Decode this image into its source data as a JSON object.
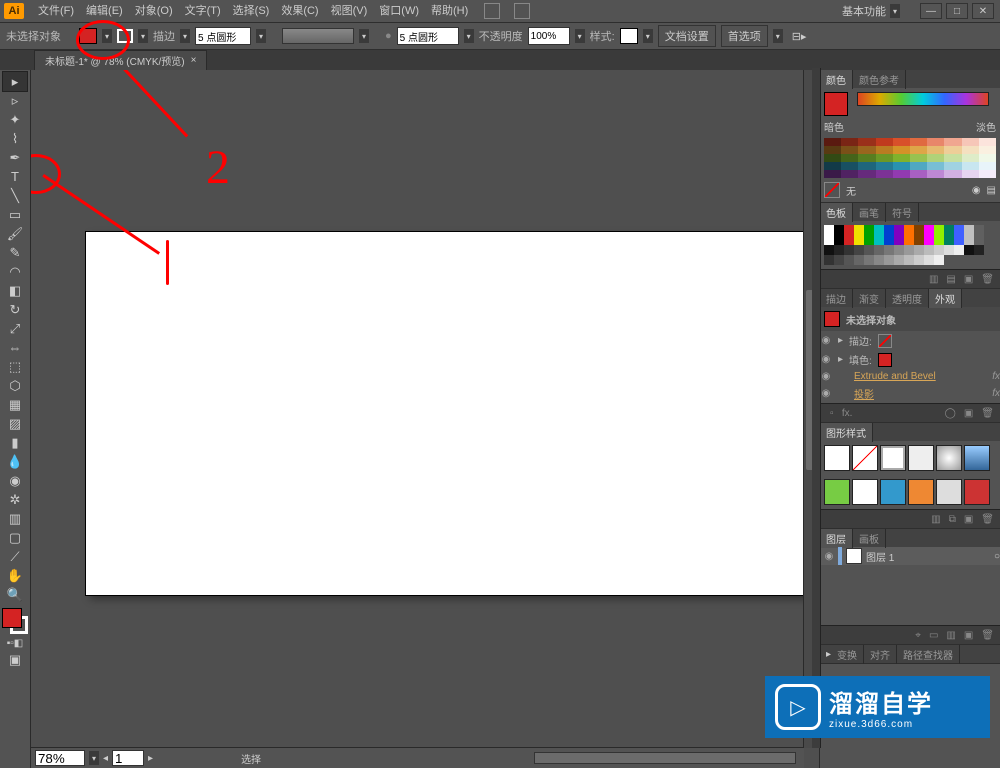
{
  "menubar": {
    "logo": "Ai",
    "items": [
      "文件(F)",
      "编辑(E)",
      "对象(O)",
      "文字(T)",
      "选择(S)",
      "效果(C)",
      "视图(V)",
      "窗口(W)",
      "帮助(H)"
    ],
    "workspace": "基本功能"
  },
  "control": {
    "status": "未选择对象",
    "stroke_label": "描边",
    "stroke_weight": "5 点圆形",
    "opacity_label": "不透明度",
    "opacity_value": "100%",
    "style_label": "样式:",
    "doc_setup": "文档设置",
    "prefs": "首选项"
  },
  "tab": {
    "title": "未标题-1* @ 78% (CMYK/预览)",
    "close": "×"
  },
  "bottom": {
    "zoom": "78%",
    "page": "1",
    "tool": "选择"
  },
  "panels": {
    "color": {
      "tabs": [
        "颜色",
        "颜色参考"
      ],
      "dark": "暗色",
      "light": "淡色",
      "none": "无"
    },
    "swatches": {
      "tabs": [
        "色板",
        "画笔",
        "符号"
      ]
    },
    "appearance": {
      "tabs": [
        "描边",
        "渐变",
        "透明度",
        "外观"
      ],
      "no_sel": "未选择对象",
      "rows": [
        {
          "label": "描边:",
          "link": false
        },
        {
          "label": "填色:",
          "link": false
        },
        {
          "label": "Extrude and Bevel",
          "link": true
        },
        {
          "label": "投影",
          "link": true
        }
      ]
    },
    "gstyles": {
      "tabs": [
        "图形样式"
      ]
    },
    "layers": {
      "tabs": [
        "图层",
        "画板"
      ],
      "layer1": "图层 1"
    },
    "footer": {
      "tabs": [
        "变换",
        "对齐",
        "路径查找器"
      ]
    }
  },
  "watermark": {
    "brand": "溜溜自学",
    "url": "zixue.3d66.com"
  },
  "colors": {
    "fill": "#d42323"
  },
  "annotations": {
    "num1": "1",
    "num2": "2"
  }
}
